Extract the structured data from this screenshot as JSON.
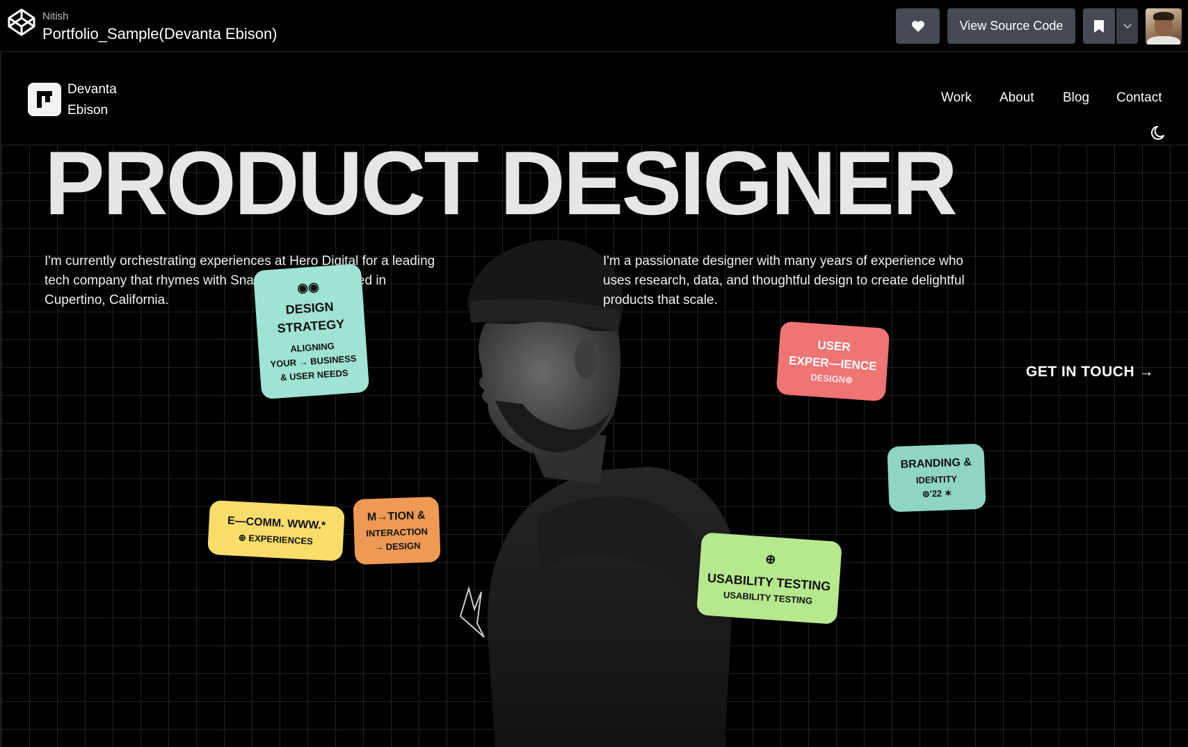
{
  "codepen": {
    "user": "Nitish",
    "title": "Portfolio_Sample(Devanta Ebison)",
    "view_source_label": "View Source Code",
    "logo_icon": "codepen-logo-icon",
    "like_icon": "heart-icon",
    "bookmark_icon": "bookmark-icon",
    "more_icon": "chevron-down-icon",
    "avatar_icon": "user-avatar"
  },
  "site": {
    "brand_first": "Devanta",
    "brand_last": "Ebison",
    "nav": [
      "Work",
      "About",
      "Blog",
      "Contact"
    ],
    "theme_icon": "moon-icon"
  },
  "hero": {
    "title": "PRODUCT DESIGNER",
    "intro_left": "I'm currently orchestrating experiences at Hero Digital for a leading tech company that rhymes with Snapple, headquartered in Cupertino, California.",
    "intro_right": "I'm a passionate designer with many years of experience who uses research, data, and thoughtful design to create delightful products that scale.",
    "cta": "GET IN TOUCH →"
  },
  "tags": {
    "strategy": {
      "glyph": "◉◉",
      "title_1": "DESIGN",
      "title_2": "STRATEGY",
      "sub_1": "ALIGNING",
      "sub_2": "YOUR → BUSINESS",
      "sub_3": "& USER NEEDS",
      "color": "#9ee3d4"
    },
    "ux": {
      "title_1": "USER",
      "title_2": "EXPER—IENCE",
      "sub_1": "DESIGN⊚",
      "color": "#ef7474"
    },
    "brand": {
      "title_1": "BRANDING &",
      "sub_1": "IDENTITY",
      "sub_2": "⊚'22 ✶",
      "color": "#8fd5c3"
    },
    "ecomm": {
      "title_1": "E—COMM. WWW.*",
      "sub_1": "⊕ EXPERIENCES",
      "color": "#f9dd6b"
    },
    "motion": {
      "title_1": "M→TION &",
      "sub_1": "INTERACTION",
      "sub_2": "→ DESIGN",
      "color": "#ee9a55"
    },
    "usability": {
      "glyph": "⊕",
      "title_1": "USABILITY TESTING",
      "sub_1": "USABILITY TESTING",
      "color": "#b6e88e"
    }
  }
}
